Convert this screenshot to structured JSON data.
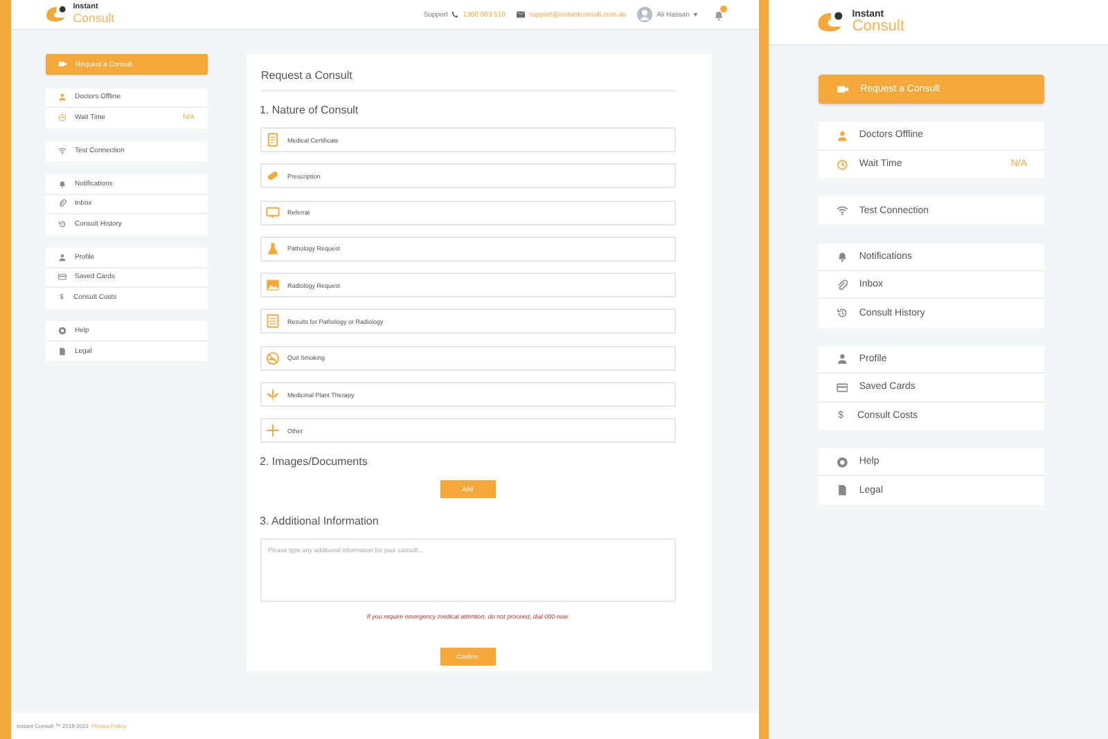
{
  "main": {
    "header": {
      "support_label": "Support",
      "phone": "1300 003 510",
      "email": "support@instantconsult.com.au",
      "user": "Ali Hassan",
      "caret": "▾"
    },
    "logo": {
      "line_1": "Instant",
      "line_2": "Consult"
    },
    "sidebar": {
      "action": "Request a Consult",
      "groups": [
        {
          "items": [
            {
              "label": "Doctors Offline"
            },
            {
              "label": "Wait Time",
              "value": "N/A"
            }
          ]
        },
        {
          "items": [
            {
              "label": "Test Connection"
            }
          ]
        },
        {
          "items": [
            {
              "label": "Notifications"
            },
            {
              "label": "Inbox"
            },
            {
              "label": "Consult History"
            }
          ]
        },
        {
          "items": [
            {
              "label": "Profile"
            },
            {
              "label": "Saved Cards"
            },
            {
              "label": "Consult Costs",
              "glyph": "$"
            }
          ]
        },
        {
          "items": [
            {
              "label": "Help"
            },
            {
              "label": "Legal"
            }
          ]
        }
      ]
    },
    "form": {
      "title": "Request a Consult",
      "section_1": "1. Nature of Consult",
      "options": [
        {
          "label": "Medical Certificate"
        },
        {
          "label": "Prescription"
        },
        {
          "label": "Referral"
        },
        {
          "label": "Pathology Request"
        },
        {
          "label": "Radiology Request"
        },
        {
          "label": "Results for Pathology or Radiology"
        },
        {
          "label": "Quit Smoking"
        },
        {
          "label": "Medicinal Plant Therapy"
        },
        {
          "label": "Other"
        }
      ],
      "section_2": "2. Images/Documents",
      "add_button": "Add",
      "section_3": "3. Additional Information",
      "info_field": {
        "placeholder": "Please type any additional information for your consult..."
      },
      "warning": "If you require emergency medical attention, do not proceed, dial 000 now",
      "confirm_button": "Confirm"
    },
    "footer": {
      "copyright": "Instant Consult ™ 2018-2022",
      "link": "Privacy Policy"
    }
  },
  "zoom_panel": {
    "logo": {
      "line_1": "Instant",
      "line_2": "Consult"
    },
    "sidebar": {
      "action": "Request a Consult",
      "groups": [
        {
          "items": [
            {
              "label": "Doctors Offline"
            },
            {
              "label": "Wait Time",
              "value": "N/A"
            }
          ]
        },
        {
          "items": [
            {
              "label": "Test Connection"
            }
          ]
        },
        {
          "items": [
            {
              "label": "Notifications"
            },
            {
              "label": "Inbox"
            },
            {
              "label": "Consult History"
            }
          ]
        },
        {
          "items": [
            {
              "label": "Profile"
            },
            {
              "label": "Saved Cards"
            },
            {
              "label": "Consult Costs",
              "glyph": "$"
            }
          ]
        },
        {
          "items": [
            {
              "label": "Help"
            },
            {
              "label": "Legal"
            }
          ]
        }
      ]
    }
  }
}
